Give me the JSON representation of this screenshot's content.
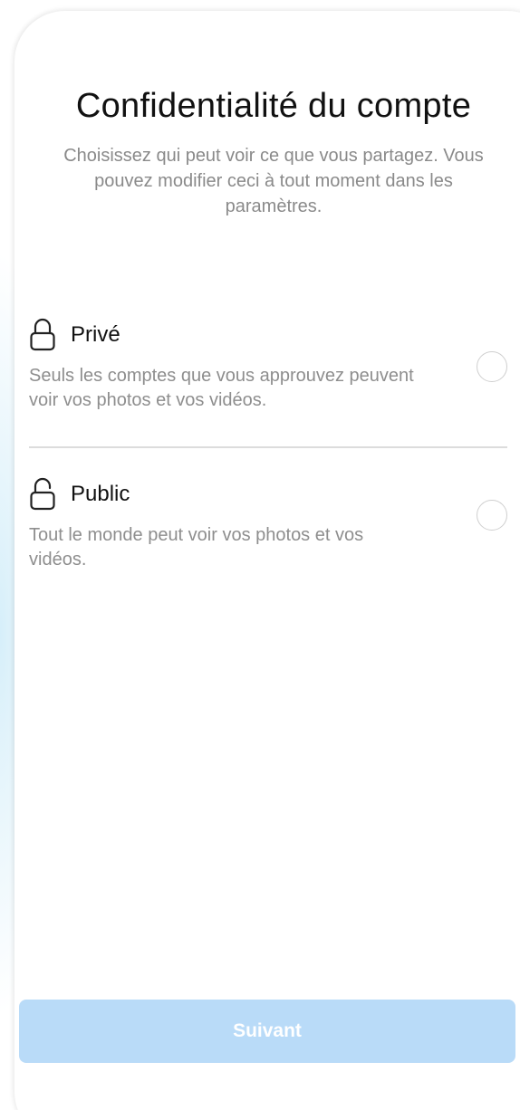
{
  "screen": {
    "title": "Confidentialité du compte",
    "subtitle": "Choisissez qui peut voir ce que vous partagez. Vous pouvez modifier ceci à tout moment dans les paramètres."
  },
  "options": [
    {
      "icon": "lock-closed-icon",
      "label": "Privé",
      "description": "Seuls les comptes que vous approuvez peuvent voir vos photos et vos vidéos.",
      "selected": false
    },
    {
      "icon": "lock-open-icon",
      "label": "Public",
      "description": "Tout le monde peut voir vos photos et vos vidéos.",
      "selected": false
    }
  ],
  "footer": {
    "next_label": "Suivant",
    "next_enabled": false
  },
  "colors": {
    "primary_disabled": "#b9dbf8",
    "text_primary": "#111111",
    "text_secondary": "#8e8e8e",
    "divider": "#dcdcdc"
  }
}
